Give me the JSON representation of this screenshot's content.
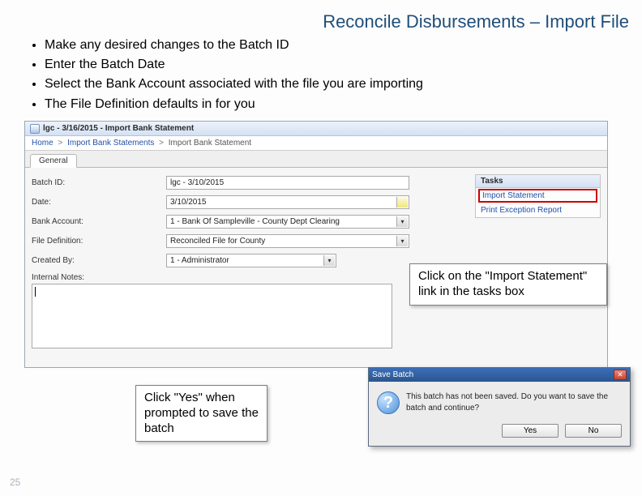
{
  "title": "Reconcile Disbursements – Import File",
  "bullets": [
    "Make any desired changes to the Batch ID",
    "Enter the Batch Date",
    "Select the Bank Account associated with the file you are importing",
    "The File Definition defaults in for you"
  ],
  "app": {
    "window_title": "lgc - 3/16/2015 - Import Bank Statement",
    "breadcrumb": {
      "root": "Home",
      "mid": "Import Bank Statements",
      "current": "Import Bank Statement"
    },
    "tab": "General",
    "fields": {
      "batch_id_label": "Batch ID:",
      "batch_id_value": "lgc - 3/10/2015",
      "date_label": "Date:",
      "date_value": "3/10/2015",
      "bank_label": "Bank Account:",
      "bank_value": "1 - Bank Of Sampleville - County Dept Clearing",
      "filedef_label": "File Definition:",
      "filedef_value": "Reconciled File for County",
      "createdby_label": "Created By:",
      "createdby_value": "1 - Administrator",
      "notes_label": "Internal Notes:"
    },
    "tasks": {
      "header": "Tasks",
      "import": "Import Statement",
      "print": "Print Exception Report"
    }
  },
  "callouts": {
    "import": "Click on the \"Import Statement\" link in the tasks box",
    "save": "Click \"Yes\" when prompted to save the batch"
  },
  "dialog": {
    "title": "Save Batch",
    "message": "This batch has not been saved. Do you want to save the batch and continue?",
    "yes": "Yes",
    "no": "No"
  },
  "page_number": "25"
}
